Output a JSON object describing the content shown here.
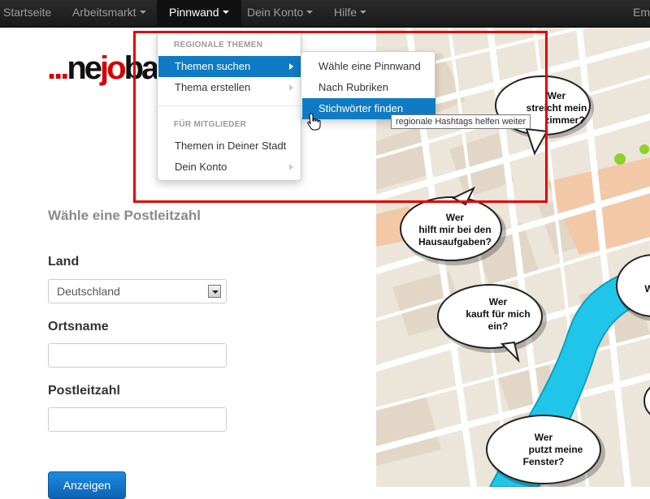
{
  "navbar": {
    "items": [
      {
        "label": "Startseite",
        "has_caret": false
      },
      {
        "label": "Arbeitsmarkt",
        "has_caret": true
      },
      {
        "label": "Pinnwand",
        "has_caret": true,
        "active": true
      },
      {
        "label": "Dein Konto",
        "has_caret": true
      },
      {
        "label": "Hilfe",
        "has_caret": true
      },
      {
        "label": "Em",
        "has_caret": false
      }
    ]
  },
  "logo": {
    "dots": "...",
    "part1": "ne",
    "part2": "jo",
    "part3": "ba"
  },
  "form": {
    "title": "Wähle eine Postleitzahl",
    "country_label": "Land",
    "country_value": "Deutschland",
    "city_label": "Ortsname",
    "city_value": "",
    "zip_label": "Postleitzahl",
    "zip_value": "",
    "submit_label": "Anzeigen"
  },
  "dropdown": {
    "header_regional": "REGIONALE THEMEN",
    "items_regional": [
      {
        "label": "Themen suchen",
        "active": true
      },
      {
        "label": "Thema erstellen",
        "active": false
      }
    ],
    "header_members": "FÜR MITGLIEDER",
    "items_members": [
      {
        "label": "Themen in Deiner Stadt"
      },
      {
        "label": "Dein Konto"
      }
    ]
  },
  "submenu": {
    "items": [
      {
        "label": "Wähle eine Pinnwand",
        "active": false
      },
      {
        "label": "Nach Rubriken",
        "active": false
      },
      {
        "label": "Stichwörter finden",
        "active": true
      }
    ]
  },
  "tooltip": {
    "text": "regionale Hashtags helfen weiter"
  },
  "map": {
    "bubbles": [
      {
        "line1": "Wer",
        "line2": "streicht mein",
        "line3": "zimmer?"
      },
      {
        "line1": "Wer",
        "line2": "hilft mir bei den",
        "line3": "Hausaufgaben?"
      },
      {
        "line1": "Wer",
        "line2": "kauft für mich",
        "line3": "ein?"
      },
      {
        "line1": "Wer",
        "line2": "putzt meine",
        "line3": "Fenster?"
      },
      {
        "line1": "W",
        "line2": "",
        "line3": ""
      }
    ]
  },
  "colors": {
    "accent": "#0f7bc4",
    "highlight": "#e40000",
    "logo_red": "#d40000",
    "river": "#1fc6ea",
    "park": "#8fd12a"
  }
}
